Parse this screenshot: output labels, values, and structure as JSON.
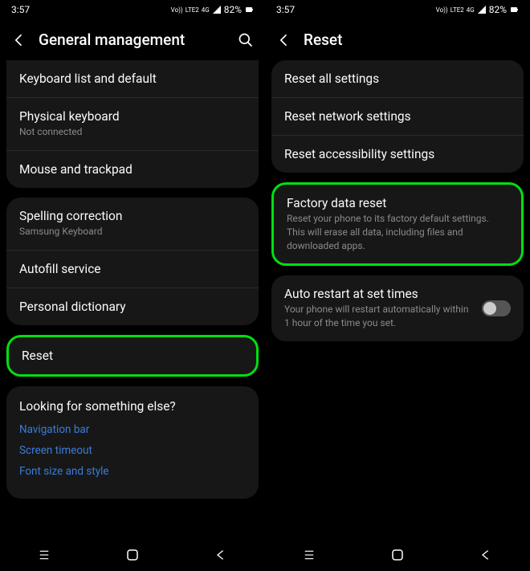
{
  "status": {
    "time": "3:57",
    "battery": "82%",
    "net": "4G",
    "lte": "LTE2",
    "vo": "Vo))"
  },
  "left": {
    "header": "General management",
    "group1": {
      "item1": {
        "title": "Keyboard list and default"
      },
      "item2": {
        "title": "Physical keyboard",
        "sub": "Not connected"
      },
      "item3": {
        "title": "Mouse and trackpad"
      }
    },
    "group2": {
      "item1": {
        "title": "Spelling correction",
        "sub": "Samsung Keyboard"
      },
      "item2": {
        "title": "Autofill service"
      },
      "item3": {
        "title": "Personal dictionary"
      }
    },
    "group3": {
      "item1": {
        "title": "Reset"
      }
    },
    "suggest": {
      "title": "Looking for something else?",
      "link1": "Navigation bar",
      "link2": "Screen timeout",
      "link3": "Font size and style"
    }
  },
  "right": {
    "header": "Reset",
    "group1": {
      "item1": {
        "title": "Reset all settings"
      },
      "item2": {
        "title": "Reset network settings"
      },
      "item3": {
        "title": "Reset accessibility settings"
      }
    },
    "group2": {
      "item1": {
        "title": "Factory data reset",
        "sub": "Reset your phone to its factory default settings. This will erase all data, including files and downloaded apps."
      }
    },
    "group3": {
      "item1": {
        "title": "Auto restart at set times",
        "sub": "Your phone will restart automatically within 1 hour of the time you set."
      }
    }
  }
}
